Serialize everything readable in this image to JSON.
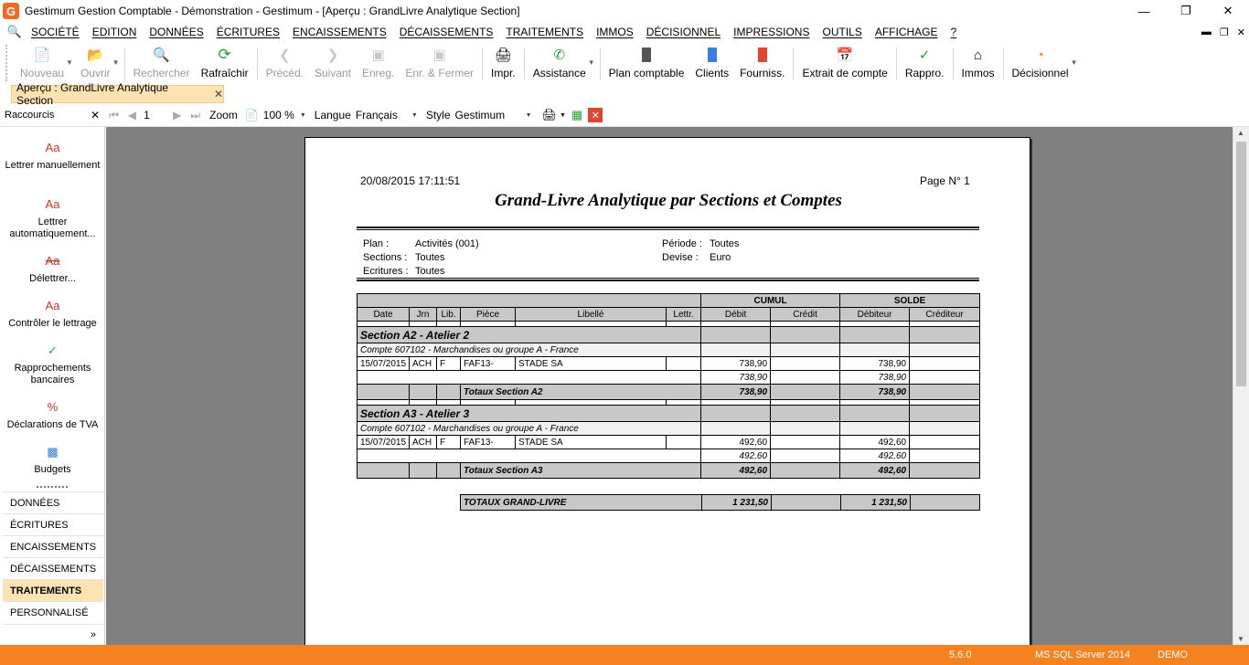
{
  "window": {
    "title": "Gestimum Gestion Comptable - Démonstration - Gestimum - [Aperçu : GrandLivre Analytique Section]"
  },
  "menu": [
    "SOCIÉTÉ",
    "EDITION",
    "DONNÉES",
    "ÉCRITURES",
    "ENCAISSEMENTS",
    "DÉCAISSEMENTS",
    "TRAITEMENTS",
    "IMMOS",
    "DÉCISIONNEL",
    "IMPRESSIONS",
    "OUTILS",
    "AFFICHAGE",
    "?"
  ],
  "toolbar": {
    "nouveau": "Nouveau",
    "ouvrir": "Ouvrir",
    "rechercher": "Rechercher",
    "rafraichir": "Rafraîchir",
    "preced": "Précéd.",
    "suivant": "Suivant",
    "enreg": "Enreg.",
    "enr_fermer": "Enr. & Fermer",
    "impr": "Impr.",
    "assistance": "Assistance",
    "plan_comptable": "Plan comptable",
    "clients": "Clients",
    "fourniss": "Fourniss.",
    "extrait": "Extrait de compte",
    "rappro": "Rappro.",
    "immos": "Immos",
    "decisionnel": "Décisionnel"
  },
  "doc_tab": {
    "label": "Aperçu : GrandLivre Analytique Section"
  },
  "preview_bar": {
    "shortcuts_label": "Raccourcis",
    "page_number": "1",
    "zoom_label": "Zoom",
    "zoom_value": "100 %",
    "language_label": "Langue",
    "language_value": "Français",
    "style_label": "Style",
    "style_value": "Gestimum"
  },
  "shortcuts": [
    "Lettrer manuellement",
    "Lettrer automatiquement...",
    "Délettrer...",
    "Contrôler le lettrage",
    "Rapprochements bancaires",
    "Déclarations de TVA",
    "Budgets"
  ],
  "nav": [
    "DONNÉES",
    "ÉCRITURES",
    "ENCAISSEMENTS",
    "DÉCAISSEMENTS",
    "TRAITEMENTS",
    "PERSONNALISÉ"
  ],
  "nav_active": "TRAITEMENTS",
  "report": {
    "datetime": "20/08/2015 17:11:51",
    "page": "Page N° 1",
    "title": "Grand-Livre Analytique par Sections et Comptes",
    "plan_label": "Plan :",
    "plan_value": "Activités (001)",
    "sections_label": "Sections :",
    "sections_value": "Toutes",
    "ecritures_label": "Ecritures :",
    "ecritures_value": "Toutes",
    "periode_label": "Période :",
    "periode_value": "Toutes",
    "devise_label": "Devise :",
    "devise_value": "Euro",
    "group_cumul": "CUMUL",
    "group_solde": "SOLDE",
    "columns": [
      "Date",
      "Jrn",
      "Lib.",
      "Pièce",
      "Libellé",
      "Lettr.",
      "Débit",
      "Crédit",
      "Débiteur",
      "Créditeur"
    ],
    "sections": [
      {
        "title": "Section A2 - Atelier 2",
        "account": "Compte 607102 - Marchandises ou groupe A - France",
        "row": {
          "date": "15/07/2015",
          "jrn": "ACH",
          "lib": "F",
          "piece": "FAF13-",
          "libelle": "STADE SA",
          "debit": "738,90",
          "debiteur": "738,90"
        },
        "subtotal_debit": "738,90",
        "subtotal_debiteur": "738,90",
        "total_label": "Totaux Section A2",
        "total_debit": "738,90",
        "total_debiteur": "738,90"
      },
      {
        "title": "Section A3 - Atelier 3",
        "account": "Compte 607102 - Marchandises ou groupe A - France",
        "row": {
          "date": "15/07/2015",
          "jrn": "ACH",
          "lib": "F",
          "piece": "FAF13-",
          "libelle": "STADE SA",
          "debit": "492,60",
          "debiteur": "492,60"
        },
        "subtotal_debit": "492,60",
        "subtotal_debiteur": "492,60",
        "total_label": "Totaux Section A3",
        "total_debit": "492,60",
        "total_debiteur": "492,60"
      }
    ],
    "grand_total_label": "TOTAUX GRAND-LIVRE",
    "grand_total_debit": "1 231,50",
    "grand_total_debiteur": "1 231,50"
  },
  "status": {
    "version": "5.6.0",
    "server": "MS SQL Server 2014",
    "mode": "DEMO"
  },
  "colors": {
    "accent_orange": "#f58220",
    "tab_highlight": "#fde3b4",
    "preview_bg": "#808080"
  }
}
